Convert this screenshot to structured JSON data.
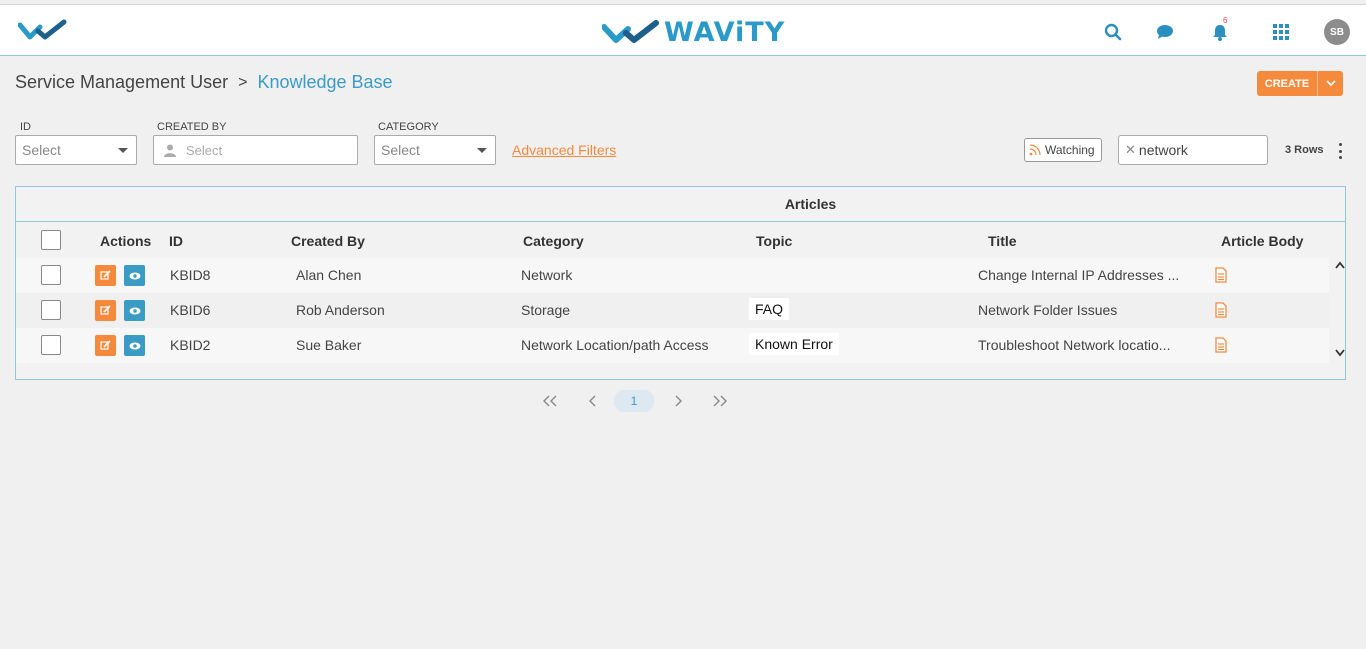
{
  "header": {
    "brand": "WAViTY",
    "notification_count": "6",
    "avatar_initials": "SB"
  },
  "breadcrumb": {
    "root": "Service Management User",
    "separator": ">",
    "current": "Knowledge Base"
  },
  "toolbar": {
    "create_label": "CREATE"
  },
  "filters": {
    "id": {
      "label": "ID",
      "placeholder": "Select"
    },
    "created_by": {
      "label": "CREATED BY",
      "placeholder": "Select"
    },
    "category": {
      "label": "CATEGORY",
      "placeholder": "Select"
    },
    "advanced_label": "Advanced Filters",
    "watching_label": "Watching",
    "search_value": "network",
    "rows_count": "3 Rows"
  },
  "grid": {
    "title": "Articles",
    "columns": {
      "actions": "Actions",
      "id": "ID",
      "created_by": "Created By",
      "category": "Category",
      "topic": "Topic",
      "title": "Title",
      "article_body": "Article Body"
    },
    "rows": [
      {
        "id": "KBID8",
        "created_by": "Alan Chen",
        "category": "Network",
        "topic": "",
        "title": "Change Internal IP Addresses ..."
      },
      {
        "id": "KBID6",
        "created_by": "Rob Anderson",
        "category": "Storage",
        "topic": "FAQ",
        "title": "Network Folder Issues"
      },
      {
        "id": "KBID2",
        "created_by": "Sue Baker",
        "category": "Network Location/path Access",
        "topic": "Known Error",
        "title": "Troubleshoot Network locatio..."
      }
    ]
  },
  "pagination": {
    "current_page": "1"
  },
  "colors": {
    "accent_orange": "#f58a3d",
    "accent_blue": "#3a9cc5"
  }
}
